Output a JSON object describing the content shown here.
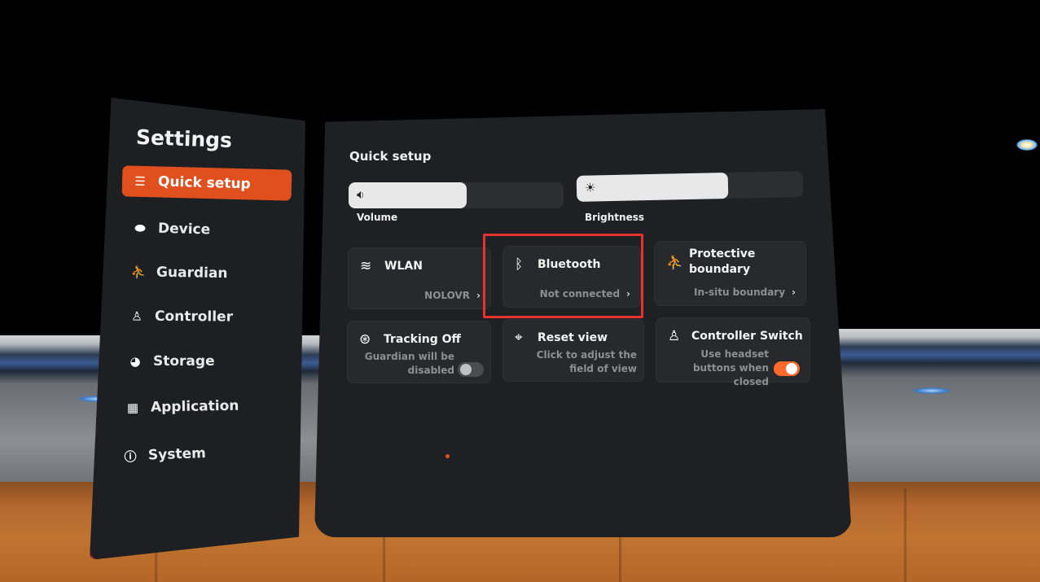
{
  "sidebar": {
    "title": "Settings",
    "items": [
      {
        "label": "Quick setup",
        "icon": "toggles-icon",
        "active": true
      },
      {
        "label": "Device",
        "icon": "headset-icon",
        "active": false
      },
      {
        "label": "Guardian",
        "icon": "guardian-icon",
        "active": false
      },
      {
        "label": "Controller",
        "icon": "controller-icon",
        "active": false
      },
      {
        "label": "Storage",
        "icon": "pie-chart-icon",
        "active": false
      },
      {
        "label": "Application",
        "icon": "grid-icon",
        "active": false
      },
      {
        "label": "System",
        "icon": "info-icon",
        "active": false
      }
    ]
  },
  "quick_setup": {
    "title": "Quick setup",
    "volume": {
      "label": "Volume",
      "level_fraction": 0.55,
      "icon": "speaker-icon"
    },
    "brightness": {
      "label": "Brightness",
      "level_fraction": 0.67,
      "icon": "sun-icon"
    },
    "tiles": {
      "wlan": {
        "title": "WLAN",
        "value": "NOLOVR",
        "icon": "wifi-icon"
      },
      "bluetooth": {
        "title": "Bluetooth",
        "value": "Not connected",
        "icon": "bluetooth-icon"
      },
      "boundary": {
        "title": "Protective boundary",
        "value": "In-situ boundary",
        "icon": "guardian-icon"
      },
      "tracking": {
        "title": "Tracking Off",
        "desc": "Guardian will be disabled",
        "toggle": false,
        "icon": "tracking-icon"
      },
      "reset_view": {
        "title": "Reset view",
        "desc": "Click to adjust the field of view",
        "icon": "crosshair-icon"
      },
      "controller_switch": {
        "title": "Controller Switch",
        "desc": "Use headset buttons when closed",
        "toggle": true,
        "icon": "controller-icon"
      }
    }
  },
  "colors": {
    "accent": "#e0501f",
    "toggle_on": "#ff6a2a",
    "highlight_box": "#e5322b",
    "panel_bg": "#1f2023"
  }
}
